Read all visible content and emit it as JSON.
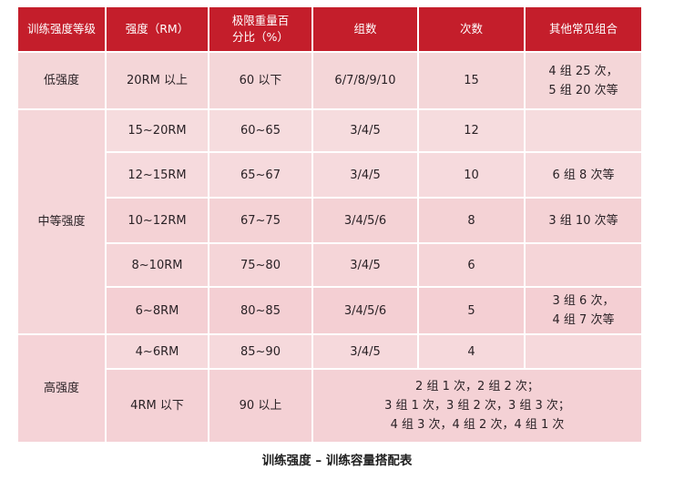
{
  "table": {
    "headers": [
      "训练强度等级",
      "强度（RM）",
      "极限重量百分比（%）",
      "组数",
      "次数",
      "其他常见组合"
    ],
    "levels": [
      "低强度",
      "中等强度",
      "高强度"
    ],
    "rows": [
      {
        "rm": "20RM 以上",
        "percent": "60 以下",
        "sets": "6/7/8/9/10",
        "reps": "15",
        "combos": [
          "4 组 25 次，",
          "5 组 20 次等"
        ]
      },
      {
        "rm": "15~20RM",
        "percent": "60~65",
        "sets": "3/4/5",
        "reps": "12",
        "combos": []
      },
      {
        "rm": "12~15RM",
        "percent": "65~67",
        "sets": "3/4/5",
        "reps": "10",
        "combos": [
          "6 组 8 次等"
        ]
      },
      {
        "rm": "10~12RM",
        "percent": "67~75",
        "sets": "3/4/5/6",
        "reps": "8",
        "combos": [
          "3 组 10 次等"
        ]
      },
      {
        "rm": "8~10RM",
        "percent": "75~80",
        "sets": "3/4/5",
        "reps": "6",
        "combos": []
      },
      {
        "rm": "6~8RM",
        "percent": "80~85",
        "sets": "3/4/5/6",
        "reps": "5",
        "combos": [
          "3 组 6 次，",
          "4 组 7 次等"
        ]
      },
      {
        "rm": "4~6RM",
        "percent": "85~90",
        "sets": "3/4/5",
        "reps": "4",
        "combos": []
      },
      {
        "rm": "4RM 以下",
        "percent": "90 以上",
        "sets": "",
        "reps": "",
        "combos": [
          "2 组 1 次，2 组 2 次；",
          "3 组 1 次，3 组 2 次，3 组 3 次；",
          "4 组 3 次，4 组 2 次，4 组 1 次"
        ]
      }
    ]
  },
  "caption": "训练强度 – 训练容量搭配表",
  "colors": {
    "header_bg": "#c41e2b",
    "header_text": "#ffffff",
    "cell_bg": "#f4d4d7"
  }
}
